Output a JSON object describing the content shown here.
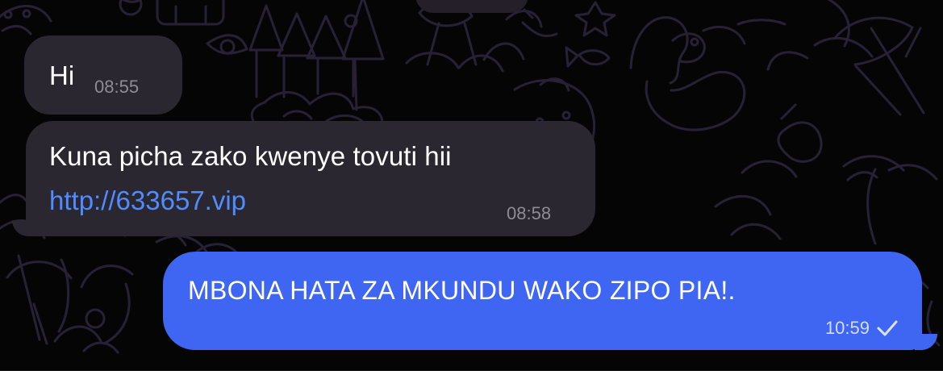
{
  "chat": {
    "background_color": "#050505",
    "doodle_color": "#272136",
    "incoming_bubble_color": "#2b2730",
    "outgoing_bubble_color": "#3e66f2",
    "link_color": "#4f8cff",
    "messages": [
      {
        "direction": "incoming",
        "text": "Hi",
        "time": "08:55"
      },
      {
        "direction": "incoming",
        "text": "Kuna picha zako kwenye tovuti hii",
        "link": "http://633657.vip",
        "time": "08:58"
      },
      {
        "direction": "outgoing",
        "text": "MBONA HATA ZA MKUNDU WAKO ZIPO PIA!.",
        "time": "10:59",
        "status_icon": "check-icon"
      }
    ]
  }
}
